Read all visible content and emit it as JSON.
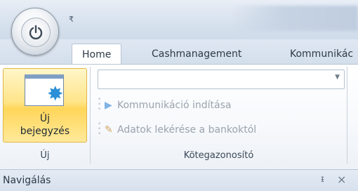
{
  "qat": {
    "dropdown_glyph": "₹"
  },
  "tabs": [
    {
      "label": "Home",
      "active": true
    },
    {
      "label": "Cashmanagement",
      "active": false
    },
    {
      "label": "Kommunikác",
      "active": false
    }
  ],
  "ribbon": {
    "group_uj": {
      "button_label_line1": "Új",
      "button_label_line2": "bejegyzés",
      "group_label": "Új"
    },
    "group_kotegazonosito": {
      "combo_value": "",
      "command_start": "Kommunikáció indítása",
      "command_fetch": "Adatok lekérése a bankoktól",
      "group_label": "Kötegazonosító"
    }
  },
  "nav_pane": {
    "title": "Navigálás",
    "pin_glyph": "ᵻ",
    "close_glyph": "×"
  },
  "colors": {
    "accent_button": "#ffd65a",
    "ribbon_border": "#b7c4d4",
    "disabled_text": "#9aa3ae"
  }
}
